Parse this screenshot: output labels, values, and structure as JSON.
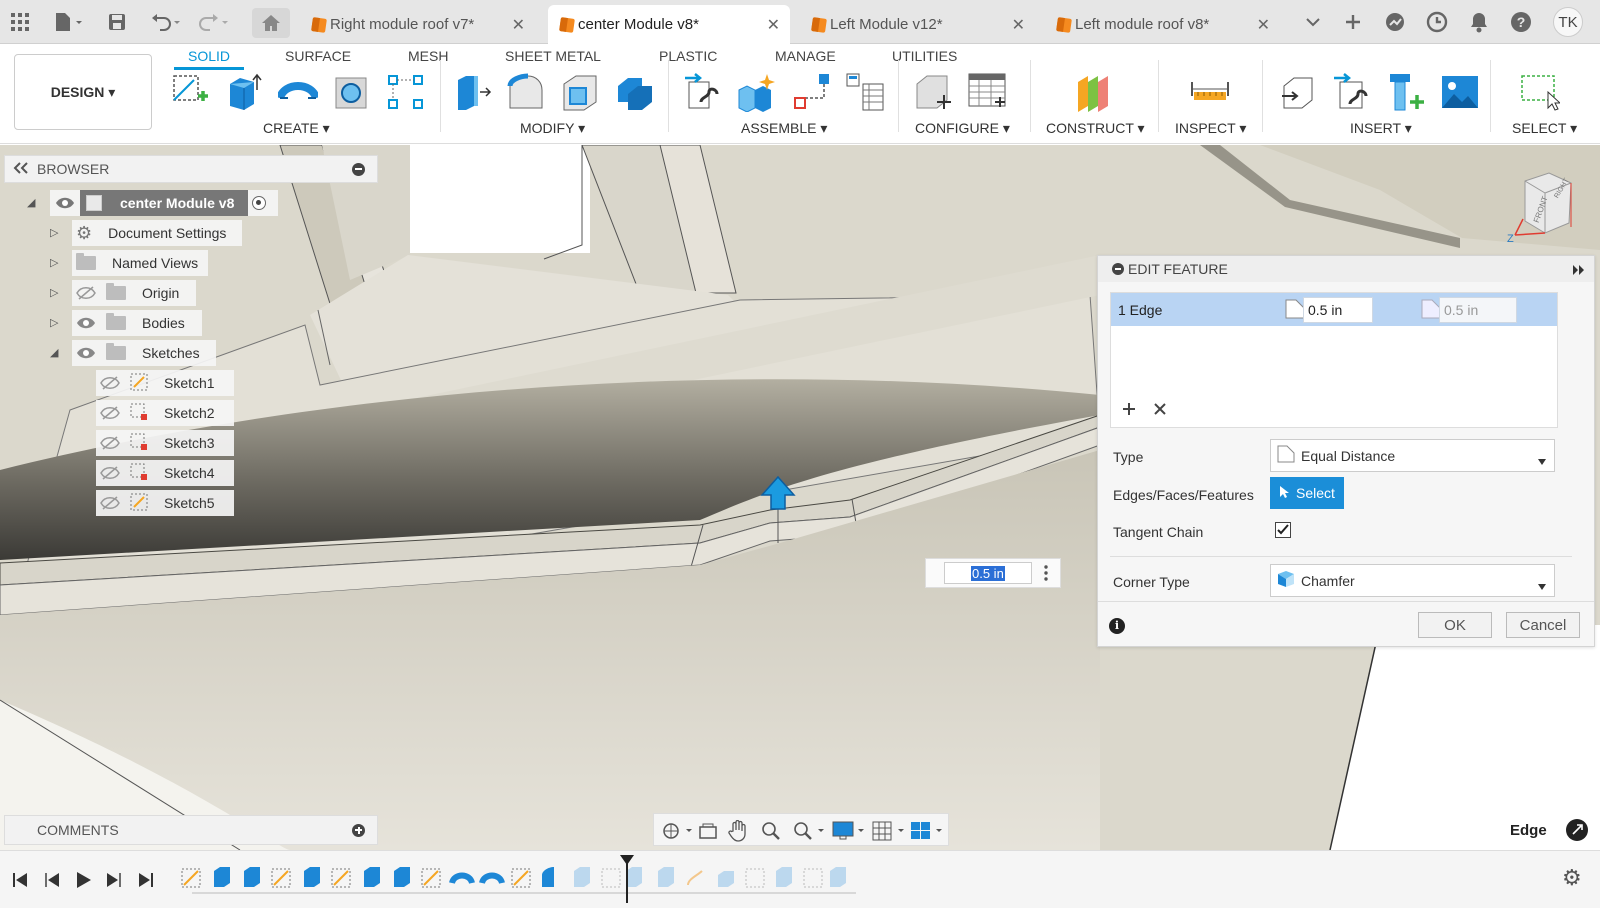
{
  "tabbar": {
    "tabs": [
      {
        "label": "Right module roof v7*",
        "active": false
      },
      {
        "label": "center Module v8*",
        "active": true
      },
      {
        "label": "Left Module v12*",
        "active": false
      },
      {
        "label": "Left module roof v8*",
        "active": false
      }
    ],
    "user_initials": "TK"
  },
  "ribbon": {
    "design_label": "DESIGN ▾",
    "tabs": [
      "SOLID",
      "SURFACE",
      "MESH",
      "SHEET METAL",
      "PLASTIC",
      "MANAGE",
      "UTILITIES"
    ],
    "active_tab": "SOLID",
    "groups": [
      "CREATE ▾",
      "MODIFY ▾",
      "ASSEMBLE ▾",
      "CONFIGURE ▾",
      "CONSTRUCT ▾",
      "INSPECT ▾",
      "INSERT ▾",
      "SELECT ▾"
    ]
  },
  "browser": {
    "title": "BROWSER",
    "root": "center Module v8",
    "items": [
      {
        "label": "Document Settings",
        "icon": "gear-icon"
      },
      {
        "label": "Named Views",
        "icon": "folder-icon"
      },
      {
        "label": "Origin",
        "icon": "folder-icon"
      },
      {
        "label": "Bodies",
        "icon": "folder-icon"
      },
      {
        "label": "Sketches",
        "icon": "folder-icon"
      }
    ],
    "sketches": [
      "Sketch1",
      "Sketch2",
      "Sketch3",
      "Sketch4",
      "Sketch5"
    ]
  },
  "viewcube": {
    "front": "FRONT",
    "right": "RIGHT",
    "axis": "Z"
  },
  "edit_feature": {
    "title": "EDIT FEATURE",
    "row_label": "1 Edge",
    "distance1": "0.5 in",
    "distance2": "0.5 in",
    "type_label": "Type",
    "type_value": "Equal Distance",
    "edges_label": "Edges/Faces/Features",
    "select_label": "Select",
    "tangent_label": "Tangent Chain",
    "tangent_checked": true,
    "corner_label": "Corner Type",
    "corner_value": "Chamfer",
    "ok_label": "OK",
    "cancel_label": "Cancel"
  },
  "viewport": {
    "dim_value": "0.5 in"
  },
  "comments": {
    "title": "COMMENTS"
  },
  "status": {
    "selection": "Edge"
  }
}
